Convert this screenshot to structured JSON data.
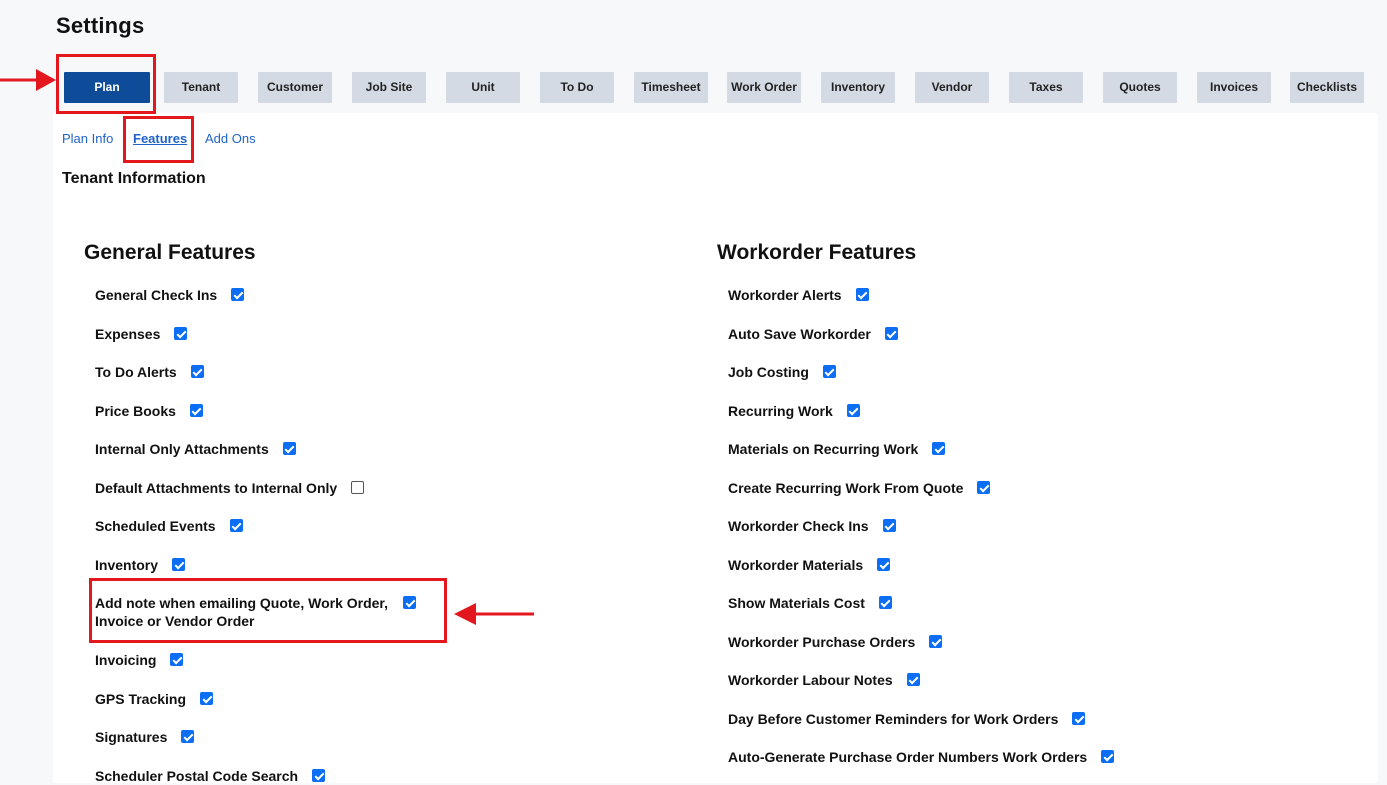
{
  "page": {
    "title": "Settings"
  },
  "tabs": [
    {
      "label": "Plan",
      "active": true
    },
    {
      "label": "Tenant"
    },
    {
      "label": "Customer"
    },
    {
      "label": "Job Site"
    },
    {
      "label": "Unit"
    },
    {
      "label": "To Do"
    },
    {
      "label": "Timesheet"
    },
    {
      "label": "Work Order"
    },
    {
      "label": "Inventory"
    },
    {
      "label": "Vendor"
    },
    {
      "label": "Taxes"
    },
    {
      "label": "Quotes"
    },
    {
      "label": "Invoices"
    },
    {
      "label": "Checklists"
    }
  ],
  "subtabs": [
    {
      "label": "Plan Info"
    },
    {
      "label": "Features",
      "active": true
    },
    {
      "label": "Add Ons"
    }
  ],
  "section": {
    "title": "Tenant Information"
  },
  "general": {
    "title": "General Features",
    "items": [
      {
        "label": "General Check Ins",
        "checked": true
      },
      {
        "label": "Expenses",
        "checked": true
      },
      {
        "label": "To Do Alerts",
        "checked": true
      },
      {
        "label": "Price Books",
        "checked": true
      },
      {
        "label": "Internal Only Attachments",
        "checked": true
      },
      {
        "label": "Default Attachments to Internal Only",
        "checked": false
      },
      {
        "label": "Scheduled Events",
        "checked": true
      },
      {
        "label": "Inventory",
        "checked": true
      },
      {
        "label": "Add note when emailing Quote, Work Order,",
        "label2": "Invoice or Vendor Order",
        "checked": true
      },
      {
        "label": "Invoicing",
        "checked": true
      },
      {
        "label": "GPS Tracking",
        "checked": true
      },
      {
        "label": "Signatures",
        "checked": true
      },
      {
        "label": "Scheduler Postal Code Search",
        "checked": true
      }
    ]
  },
  "workorder": {
    "title": "Workorder Features",
    "items": [
      {
        "label": "Workorder Alerts",
        "checked": true
      },
      {
        "label": "Auto Save Workorder",
        "checked": true
      },
      {
        "label": "Job Costing",
        "checked": true
      },
      {
        "label": "Recurring Work",
        "checked": true
      },
      {
        "label": "Materials on Recurring Work",
        "checked": true
      },
      {
        "label": "Create Recurring Work From Quote",
        "checked": true
      },
      {
        "label": "Workorder Check Ins",
        "checked": true
      },
      {
        "label": "Workorder Materials",
        "checked": true
      },
      {
        "label": "Show Materials Cost",
        "checked": true
      },
      {
        "label": "Workorder Purchase Orders",
        "checked": true
      },
      {
        "label": "Workorder Labour Notes",
        "checked": true
      },
      {
        "label": "Day Before Customer Reminders for Work Orders",
        "checked": true
      },
      {
        "label": "Auto-Generate Purchase Order Numbers Work Orders",
        "checked": true
      }
    ]
  },
  "colors": {
    "accent": "#0e4c9a",
    "link": "#1f63c9",
    "annotation": "#e3171e",
    "checkbox": "#0b6ef5"
  }
}
